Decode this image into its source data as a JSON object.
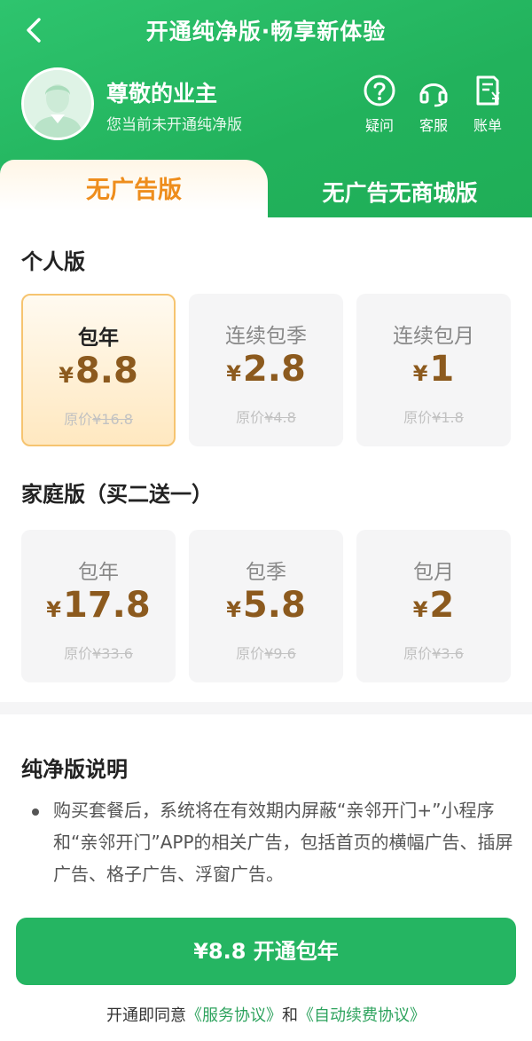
{
  "header": {
    "title": "开通纯净版·畅享新体验",
    "user_name": "尊敬的业主",
    "user_status": "您当前未开通纯净版",
    "tools": [
      {
        "icon": "question-icon",
        "label": "疑问"
      },
      {
        "icon": "headset-icon",
        "label": "客服"
      },
      {
        "icon": "bill-icon",
        "label": "账单"
      }
    ]
  },
  "tabs": {
    "active": "无广告版",
    "inactive": "无广告无商城版"
  },
  "personal": {
    "title": "个人版",
    "plans": [
      {
        "name": "包年",
        "currency": "¥",
        "price": "8.8",
        "orig_prefix": "原价",
        "orig_price": "¥16.8",
        "selected": true
      },
      {
        "name": "连续包季",
        "currency": "¥",
        "price": "2.8",
        "orig_prefix": "原价",
        "orig_price": "¥4.8",
        "selected": false
      },
      {
        "name": "连续包月",
        "currency": "¥",
        "price": "1",
        "orig_prefix": "原价",
        "orig_price": "¥1.8",
        "selected": false
      }
    ]
  },
  "family": {
    "title": "家庭版（买二送一）",
    "plans": [
      {
        "name": "包年",
        "currency": "¥",
        "price": "17.8",
        "orig_prefix": "原价",
        "orig_price": "¥33.6"
      },
      {
        "name": "包季",
        "currency": "¥",
        "price": "5.8",
        "orig_prefix": "原价",
        "orig_price": "¥9.6"
      },
      {
        "name": "包月",
        "currency": "¥",
        "price": "2",
        "orig_prefix": "原价",
        "orig_price": "¥3.6"
      }
    ]
  },
  "description": {
    "title": "纯净版说明",
    "text": "购买套餐后，系统将在有效期内屏蔽“亲邻开门+”小程序和“亲邻开门”APP的相关广告，包括首页的横幅广告、插屏广告、格子广告、浮窗广告。"
  },
  "footer": {
    "cta_label": "¥8.8 开通包年",
    "agree_prefix": "开通即同意",
    "agree_link1": "《服务协议》",
    "agree_and": "和",
    "agree_link2": "《自动续费协议》"
  },
  "colors": {
    "brand_green": "#25b562",
    "accent_orange": "#ee8d1c",
    "price_brown": "#8c5a1e"
  }
}
